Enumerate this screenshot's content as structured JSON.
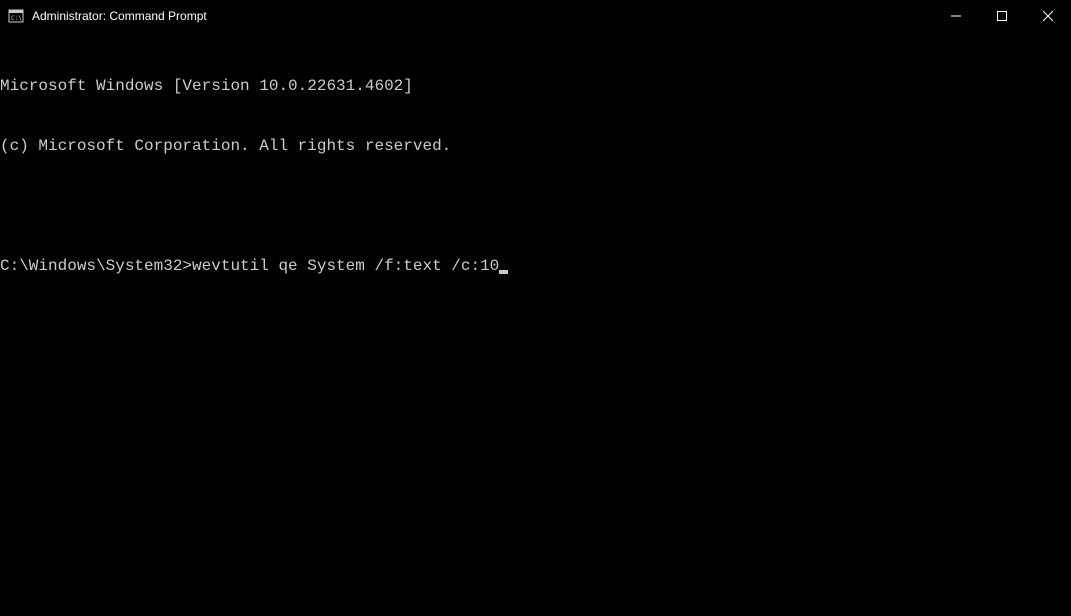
{
  "window": {
    "title": "Administrator: Command Prompt"
  },
  "terminal": {
    "header_line1": "Microsoft Windows [Version 10.0.22631.4602]",
    "header_line2": "(c) Microsoft Corporation. All rights reserved.",
    "prompt": "C:\\Windows\\System32>",
    "command": "wevtutil qe System /f:text /c:10"
  }
}
